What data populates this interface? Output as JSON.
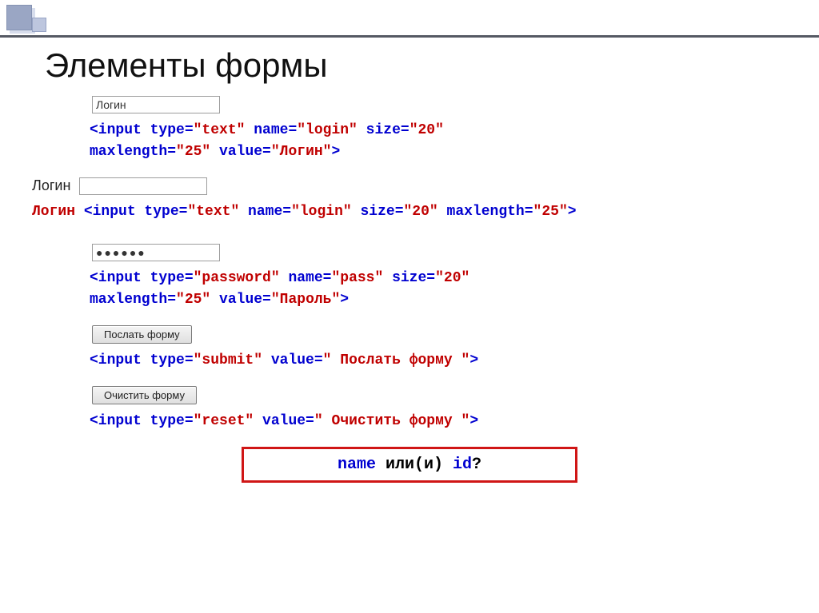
{
  "title": "Элементы формы",
  "sample": {
    "login_value": "Логин",
    "login_label": "Логин",
    "login_label_red": "Логин",
    "password_mask": "●●●●●●",
    "submit_label": "Послать форму",
    "reset_label": "Очистить форму"
  },
  "code1": {
    "l1_a": "<input type=",
    "l1_b": "\"text\"",
    "l1_c": " name=",
    "l1_d": "\"login\"",
    "l1_e": " size=",
    "l1_f": "\"20\"",
    "l2_a": "maxlength=",
    "l2_b": "\"25\"",
    "l2_c": " value=",
    "l2_d": "\"Логин\"",
    "l2_e": ">"
  },
  "code2": {
    "prefix": "Логин ",
    "a": "<input type=",
    "b": "\"text\"",
    "c": " name=",
    "d": "\"login\"",
    "e": " size=",
    "f": "\"20\"",
    "g": " maxlength=",
    "h": "\"25\"",
    "i": ">"
  },
  "code3": {
    "l1_a": "<input type=",
    "l1_b": "\"password\"",
    "l1_c": " name=",
    "l1_d": "\"pass\"",
    "l1_e": " size=",
    "l1_f": "\"20\"",
    "l2_a": "maxlength=",
    "l2_b": "\"25\"",
    "l2_c": " value=",
    "l2_d": "\"Пароль\"",
    "l2_e": ">"
  },
  "code4": {
    "a": "<input type=",
    "b": "\"submit\"",
    "c": " value=",
    "d": "\" Послать форму \"",
    "e": ">"
  },
  "code5": {
    "a": "<input type=",
    "b": "\"reset\"",
    "c": " value=",
    "d": "\" Очистить форму \"",
    "e": ">"
  },
  "question": {
    "name": "name",
    "mid": " или(и) ",
    "id": "id",
    "q": "?"
  }
}
